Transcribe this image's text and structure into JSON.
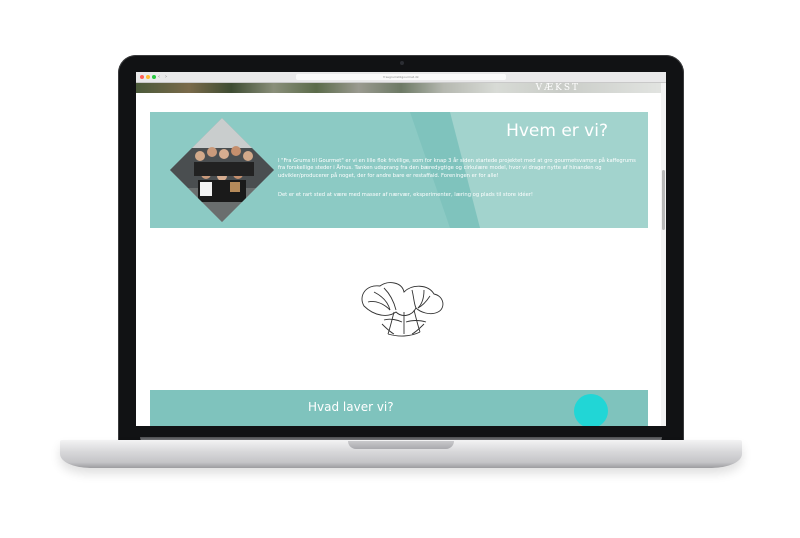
{
  "browser": {
    "url": "frasgrumstilgourmet.dk",
    "colors": {
      "close": "#ff5f57",
      "minimize": "#febc2e",
      "maximize": "#28c840"
    }
  },
  "hero": {
    "text": "VÆKST"
  },
  "about": {
    "title": "Hvem er vi?",
    "paragraph1": "I \"Fra Grums til Gourmet\" er vi en lille flok frivillige, som for knap 3 år siden startede projektet med at gro gourmetsvampe på kaffegrums fra forskellige steder i Århus. Tanken udsprang fra den bæredygtige og cirkulære model, hvor vi drager nytte af hinanden og udvikler/producerer på noget, der for andre bare er restaffald. Foreningen er for alle!",
    "paragraph2": "Det er et rart sted at være med masser af nærvær, eksperimenter, læring og plads til store idéer!",
    "color": "#7fc3bd"
  },
  "illustration": {
    "name": "oyster-mushroom-drawing"
  },
  "next_section": {
    "title": "Hvad laver vi?",
    "accent_color": "#21d6d6"
  }
}
